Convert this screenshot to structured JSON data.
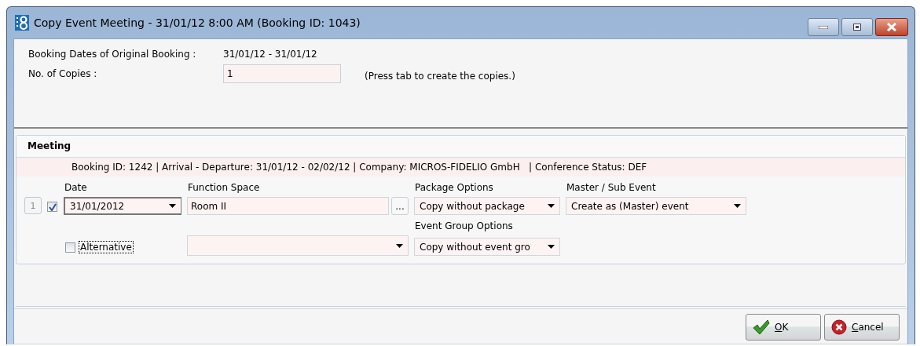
{
  "window": {
    "title": "Copy Event Meeting - 31/01/12 8:00 AM (Booking ID: 1043)"
  },
  "booking_dates": {
    "label": "Booking Dates of Original Booking :",
    "value": "31/01/12 - 31/01/12"
  },
  "copies": {
    "label": "No. of Copies  :",
    "value": "1",
    "hint": "(Press tab to create the copies.)"
  },
  "section": {
    "title": "Meeting",
    "info": "Booking ID: 1242 | Arrival - Departure: 31/01/12 - 02/02/12 | Company: MICROS-FIDELIO GmbH   | Conference Status: DEF"
  },
  "rows": [
    {
      "number": "1",
      "checked": true,
      "date": {
        "label": "Date",
        "value": "31/01/2012"
      },
      "function_space": {
        "label": "Function Space",
        "value": "Room II",
        "button": "..."
      },
      "package_options": {
        "label": "Package Options",
        "value": "Copy without package"
      },
      "master_sub_event": {
        "label": "Master / Sub Event",
        "value": "Create as (Master) event"
      },
      "event_group_options": {
        "label": "Event Group Options",
        "value": "Copy without event gro"
      },
      "alternative": {
        "label": "Alternative",
        "checked": false
      }
    }
  ],
  "buttons": [
    {
      "kind": "ok",
      "label": "OK"
    },
    {
      "kind": "cancel",
      "label": "Cancel"
    }
  ]
}
